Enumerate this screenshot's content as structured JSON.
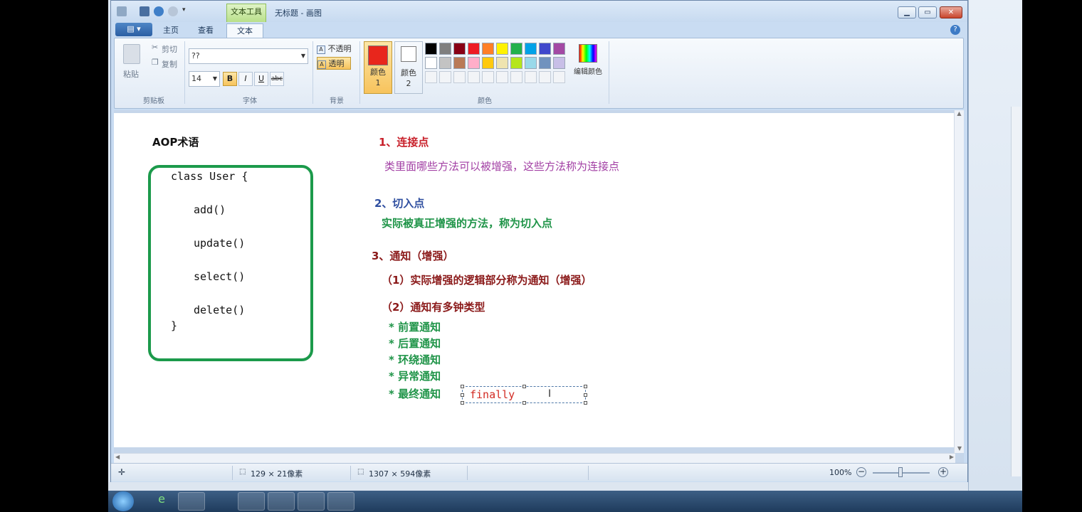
{
  "window": {
    "title": "无标题 - 画图",
    "context_tab": "文本工具",
    "tabs": [
      "主页",
      "查看",
      "文本"
    ]
  },
  "ribbon": {
    "clipboard": {
      "paste": "粘贴",
      "cut": "剪切",
      "copy": "复制",
      "label": "剪贴板"
    },
    "font": {
      "family": "??",
      "size": "14",
      "bold": "B",
      "italic": "I",
      "underline": "U",
      "strike": "abc",
      "label": "字体"
    },
    "background": {
      "opaque": "不透明",
      "transparent": "透明",
      "label": "背景"
    },
    "colors": {
      "color1_label": "颜色 1",
      "color2_label": "颜色 2",
      "color1": "#e8261c",
      "color2": "#ffffff",
      "edit": "编辑颜色",
      "label": "颜色",
      "palette_row1": [
        "#000000",
        "#7f7f7f",
        "#880015",
        "#ed1c24",
        "#ff7f27",
        "#fff200",
        "#22b14c",
        "#00a2e8",
        "#3f48cc",
        "#a349a4"
      ],
      "palette_row2": [
        "#ffffff",
        "#c3c3c3",
        "#b97a57",
        "#ffaec9",
        "#ffc90e",
        "#efe4b0",
        "#b5e61d",
        "#99d9ea",
        "#7092be",
        "#c8bfe7"
      ]
    }
  },
  "canvas": {
    "heading": "AOP术语",
    "code": [
      "class User {",
      "add()",
      "update()",
      "select()",
      "delete()",
      "}"
    ],
    "section1_title": "1、连接点",
    "section1_text": "类里面哪些方法可以被增强，这些方法称为连接点",
    "section2_title": "2、切入点",
    "section2_text": "实际被真正增强的方法，称为切入点",
    "section3_title": "3、通知（增强）",
    "section3_item1": "（1）实际增强的逻辑部分称为通知（增强）",
    "section3_item2": "（2）通知有多钟类型",
    "advice_types": [
      "* 前置通知",
      "* 后置通知",
      "* 环绕通知",
      "* 异常通知",
      "* 最终通知"
    ],
    "editing_text": "finally"
  },
  "status": {
    "selection_size": "129 × 21像素",
    "canvas_size": "1307 × 594像素",
    "zoom": "100%"
  }
}
